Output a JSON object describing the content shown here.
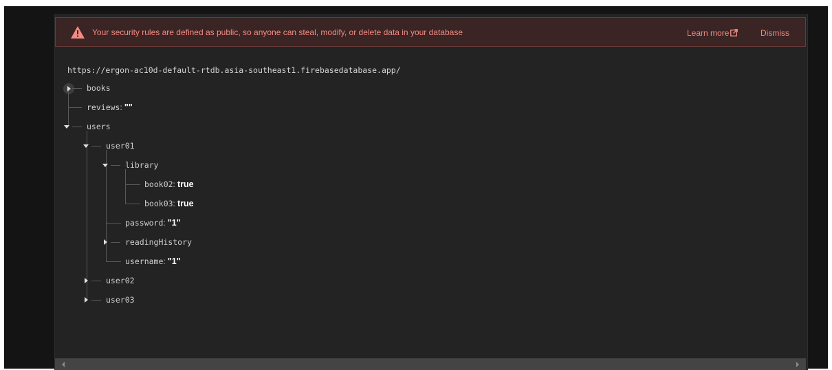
{
  "banner": {
    "message": "Your security rules are defined as public, so anyone can steal, modify, or delete data in your database",
    "learn_more": "Learn more",
    "dismiss": "Dismiss",
    "icon": "warning-icon",
    "color": "#f28b82"
  },
  "database": {
    "url": "https://ergon-ac10d-default-rtdb.asia-southeast1.firebasedatabase.app/"
  },
  "tree": {
    "books": {
      "key": "books",
      "expanded": false
    },
    "reviews": {
      "key": "reviews",
      "value": "\"\""
    },
    "users": {
      "key": "users",
      "expanded": true
    },
    "user01": {
      "key": "user01",
      "expanded": true
    },
    "library": {
      "key": "library",
      "expanded": true
    },
    "book02": {
      "key": "book02",
      "value": "true"
    },
    "book03": {
      "key": "book03",
      "value": "true"
    },
    "password": {
      "key": "password",
      "value": "\"1\""
    },
    "readingHistory": {
      "key": "readingHistory",
      "expanded": false
    },
    "username": {
      "key": "username",
      "value": "\"1\""
    },
    "user02": {
      "key": "user02",
      "expanded": false
    },
    "user03": {
      "key": "user03",
      "expanded": false
    }
  }
}
